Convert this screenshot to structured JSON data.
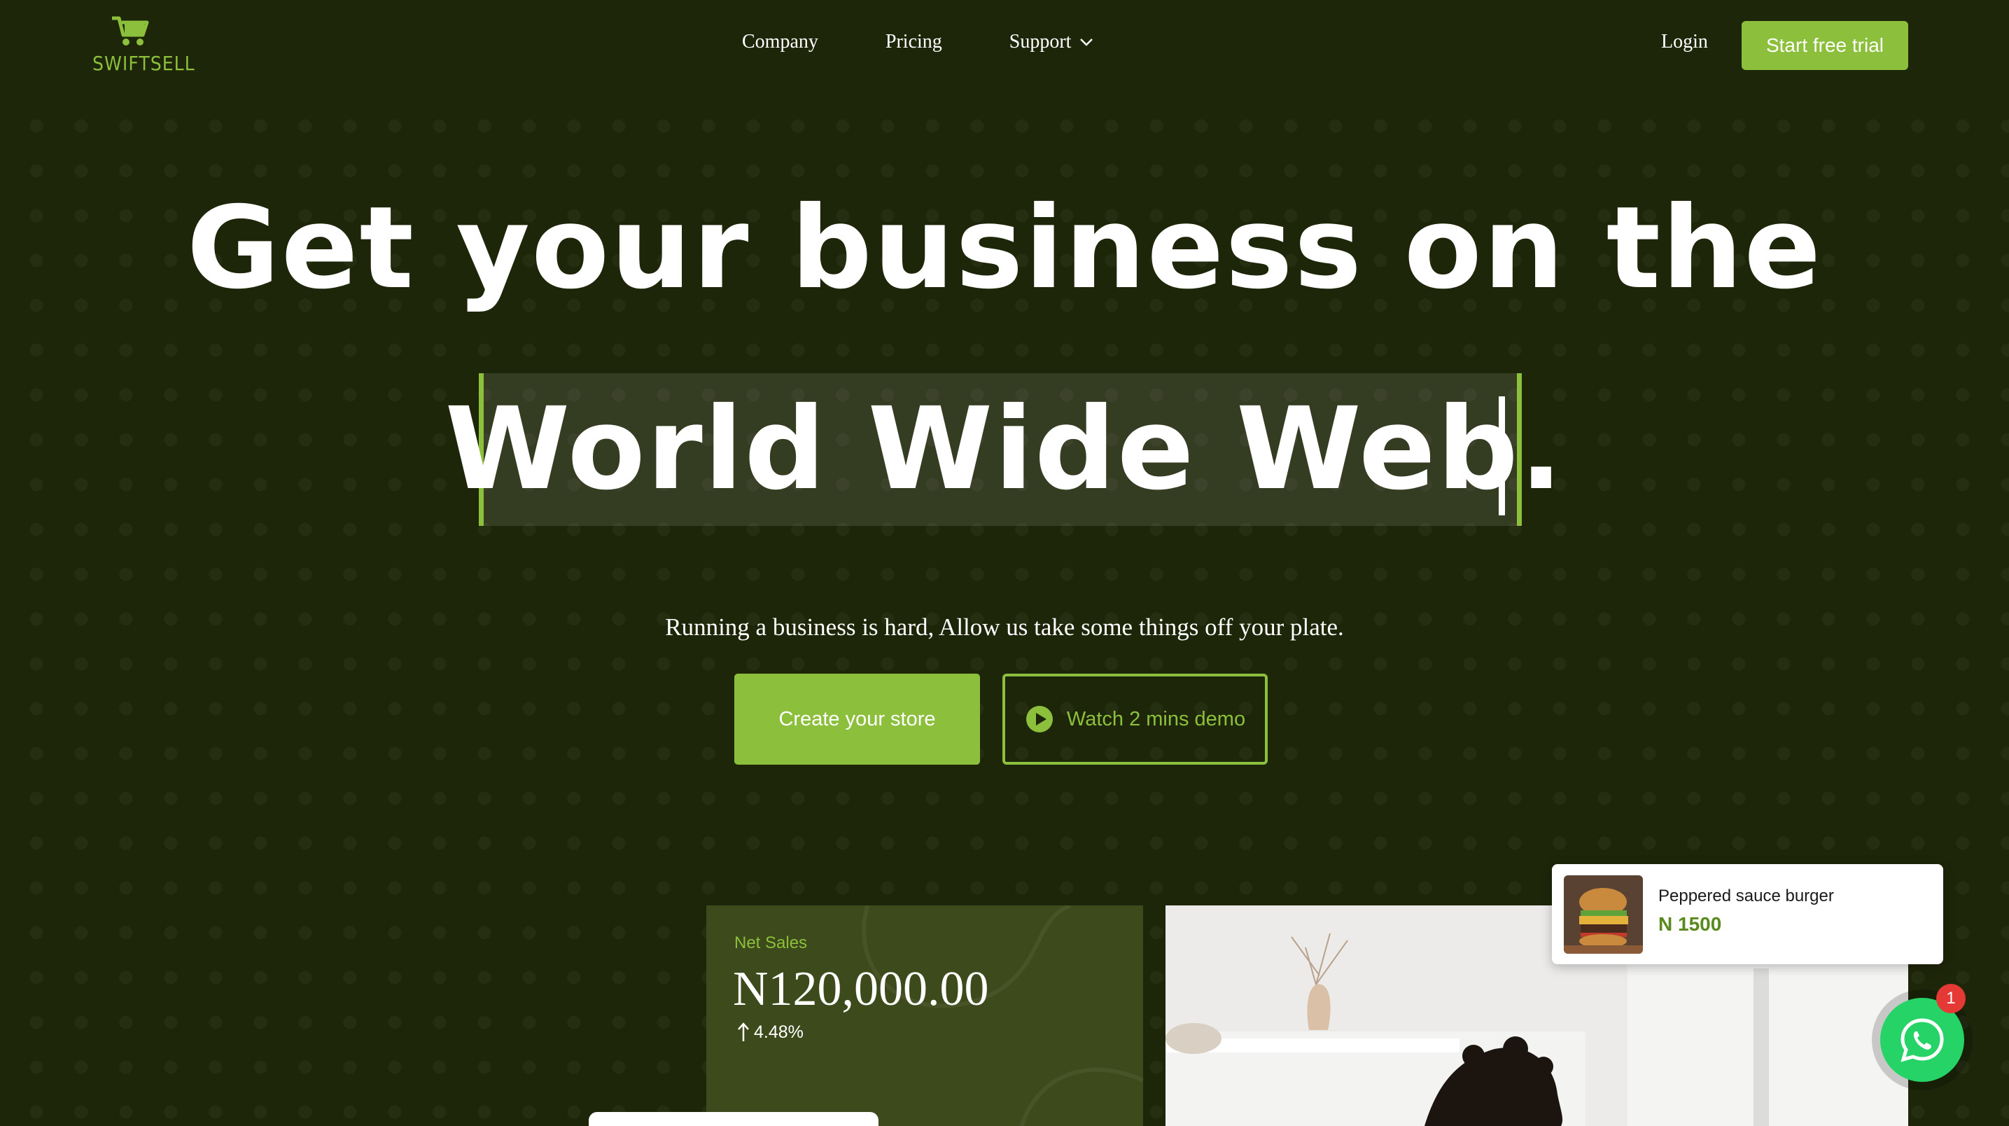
{
  "brand": {
    "name": "SWIFTSELL",
    "accent_color": "#8cbf3c",
    "background_color": "#1e2609"
  },
  "nav": {
    "items": [
      {
        "label": "Company"
      },
      {
        "label": "Pricing"
      },
      {
        "label": "Support",
        "icon": "chevron-down-icon"
      }
    ],
    "login_label": "Login",
    "trial_label": "Start free trial"
  },
  "hero": {
    "headline_line1": "Get your business on the",
    "headline_line2": "World Wide Web.",
    "subtitle": "Running a business is hard, Allow us take some things off your plate.",
    "create_store_label": "Create your store",
    "demo_label": "Watch 2 mins demo",
    "demo_icon": "play-icon"
  },
  "sales_card": {
    "label": "Net Sales",
    "value": "N120,000.00",
    "change": "4.48%",
    "change_icon": "arrow-up-icon"
  },
  "product_card": {
    "name": "Peppered sauce burger",
    "price": "N 1500",
    "image": "burger-image"
  },
  "whatsapp": {
    "icon": "whatsapp-icon",
    "badge_count": "1",
    "color": "#25d366"
  }
}
